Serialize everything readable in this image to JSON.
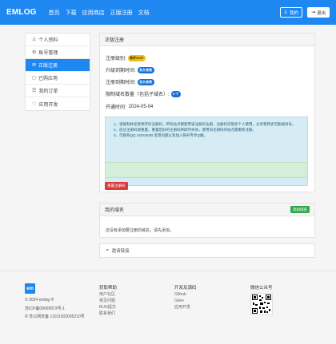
{
  "header": {
    "brand": "EMLOG",
    "nav": [
      "首页",
      "下载",
      "应用商店",
      "正版注册",
      "文档"
    ],
    "my_label": "我的",
    "logout_label": "退出"
  },
  "sidebar": {
    "items": [
      {
        "label": "个人资料",
        "icon": "user-icon",
        "glyph": "♙"
      },
      {
        "label": "账号管理",
        "icon": "gear-icon",
        "glyph": "⚙"
      },
      {
        "label": "正版注册",
        "icon": "registration-icon",
        "glyph": "✉"
      },
      {
        "label": "已购应用",
        "icon": "bag-icon",
        "glyph": "◻"
      },
      {
        "label": "我的订单",
        "icon": "order-icon",
        "glyph": "☰"
      },
      {
        "label": "应用开发",
        "icon": "code-icon",
        "glyph": "♡"
      }
    ],
    "active_index": 2
  },
  "registration": {
    "title": "正版注册",
    "level_label": "注册级别:",
    "level_badge": "铁杆SVIP",
    "upgrade_label": "升级到期时间:",
    "upgrade_badge": "永久有效",
    "expire_label": "注册到期时间:",
    "expire_badge": "永久有效",
    "domain_limit_label": "限制域名数量（包括子域名）:",
    "domain_limit_value": "5 个",
    "opened_label": "开通时间:",
    "opened_date": "2024-05-04",
    "notes": [
      "1、请复制并妥善保存好注册码，所有站点都使用该注册码注册，注册码仅限您个人使用，分享和转卖可能被封号。",
      "2、后过注册码调重置，重置后旧的注册码将即时失效，使用旧注册码的站点需重新注册。",
      "3、可联系QQ 1534452B 反馈问题以及加入铁杆专享Q群。"
    ],
    "reset_label": "重置注册码"
  },
  "domains": {
    "title": "我的域名",
    "add_label": "添加域名",
    "empty_text": "还没有添加要注册的域名，请先添加。"
  },
  "invite": {
    "label": "邀请链接"
  },
  "footer": {
    "logo_text": "em",
    "copyright": "© 2024 emlog ®",
    "icp": "苏ICP备09009973号-1",
    "police": "苏公网安备 11011502005210号",
    "help_title": "获取帮助",
    "help_links": [
      "用户社区",
      "常见问题",
      "BUG提交",
      "联系我们"
    ],
    "dev_title": "开发及源码",
    "dev_links": [
      "Github",
      "Gitee",
      "应用开发"
    ],
    "wechat_title": "微信公众号"
  },
  "colors": {
    "primary": "#1e87f0",
    "success": "#32a852",
    "danger": "#d73b3b",
    "info_bg": "#d5ecf5"
  }
}
